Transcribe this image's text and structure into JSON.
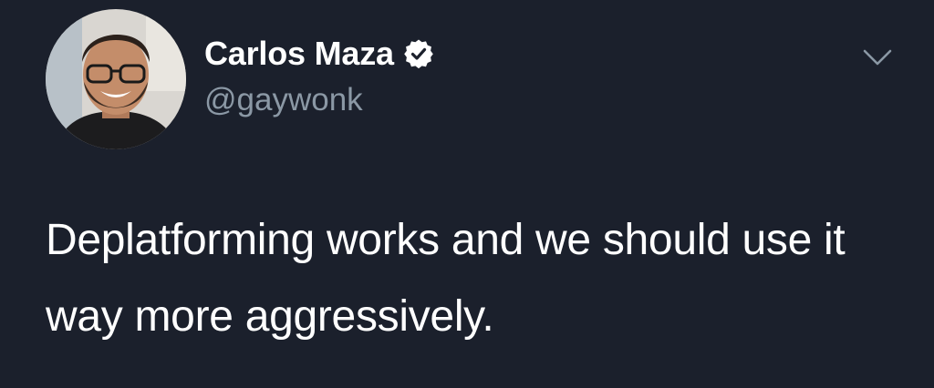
{
  "tweet": {
    "author": {
      "display_name": "Carlos Maza",
      "handle": "@gaywonk",
      "verified": true
    },
    "text": "Deplatforming works and we should use it way more aggressively."
  },
  "icons": {
    "verified": "verified-badge-icon",
    "menu": "chevron-down-icon",
    "avatar": "profile-photo"
  },
  "colors": {
    "background": "#1b202c",
    "name": "#ffffff",
    "handle": "#8b98a5",
    "text": "#ffffff"
  }
}
